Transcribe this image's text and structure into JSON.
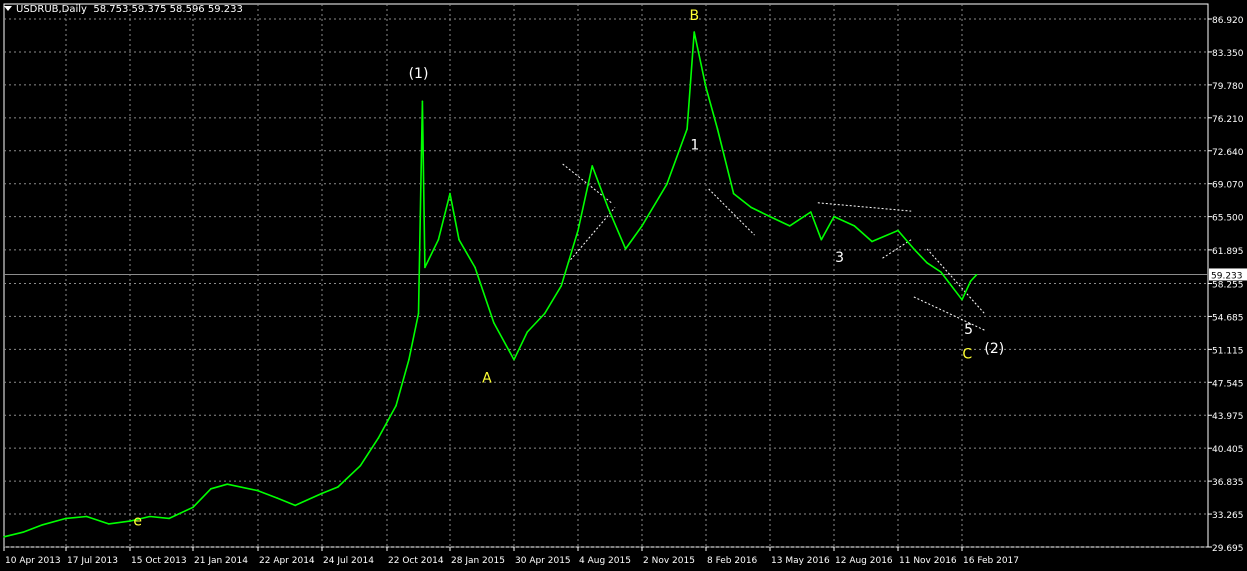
{
  "header": {
    "symbol": "USDRUB,Daily",
    "ohlc": "58.753 59.375 58.596 59.233"
  },
  "colors": {
    "background": "#000000",
    "grid": "#8c8c8c",
    "price_line": "#00ff00",
    "axis_text": "#ffffff",
    "label_yellow": "#ffff33",
    "label_white": "#ffffff",
    "current_price_line": "#8c8c8c"
  },
  "chart_data": {
    "type": "line",
    "current_price": 59.233,
    "current_price_label": "59.233",
    "ylim": [
      29.695,
      86.92
    ],
    "y_ticks": [
      "86.920",
      "83.350",
      "79.780",
      "76.210",
      "72.640",
      "69.070",
      "65.500",
      "61.895",
      "58.255",
      "54.685",
      "51.115",
      "47.545",
      "43.975",
      "40.405",
      "36.835",
      "33.265",
      "29.695"
    ],
    "x_ticks": [
      "10 Apr 2013",
      "17 Jul 2013",
      "15 Oct 2013",
      "21 Jan 2014",
      "22 Apr 2014",
      "24 Jul 2014",
      "22 Oct 2014",
      "28 Jan 2015",
      "30 Apr 2015",
      "4 Aug 2015",
      "2 Nov 2015",
      "8 Feb 2016",
      "13 May 2016",
      "12 Aug 2016",
      "11 Nov 2016",
      "16 Feb 2017"
    ],
    "series": [
      {
        "x": [
          "2013-04-10",
          "2013-05-10",
          "2013-06-10",
          "2013-07-17",
          "2013-08-15",
          "2013-09-15",
          "2013-10-15",
          "2013-11-15",
          "2013-12-15",
          "2014-01-21",
          "2014-02-15",
          "2014-03-10",
          "2014-04-22",
          "2014-05-20",
          "2014-06-15",
          "2014-07-24",
          "2014-08-15",
          "2014-09-15",
          "2014-10-10",
          "2014-11-05",
          "2014-11-25",
          "2014-12-10",
          "2014-12-16",
          "2014-12-20",
          "2015-01-10",
          "2015-01-28",
          "2015-02-10",
          "2015-03-05",
          "2015-04-01",
          "2015-04-30",
          "2015-05-20",
          "2015-06-15",
          "2015-07-10",
          "2015-08-04",
          "2015-08-24",
          "2015-09-15",
          "2015-10-10",
          "2015-11-02",
          "2015-12-10",
          "2016-01-10",
          "2016-01-21",
          "2016-02-08",
          "2016-02-25",
          "2016-03-20",
          "2016-04-15",
          "2016-05-13",
          "2016-06-10",
          "2016-07-10",
          "2016-07-25",
          "2016-08-12",
          "2016-09-10",
          "2016-10-05",
          "2016-11-11",
          "2016-12-05",
          "2016-12-25",
          "2017-01-15",
          "2017-02-16",
          "2017-03-01",
          "2017-03-10"
        ],
        "y": [
          30.8,
          31.3,
          32.1,
          32.8,
          33.0,
          32.2,
          32.5,
          33.0,
          32.8,
          34.0,
          36.0,
          36.5,
          35.8,
          35.0,
          34.2,
          35.5,
          36.2,
          38.5,
          41.5,
          45.0,
          50.0,
          55.0,
          78.0,
          60.0,
          63.0,
          68.0,
          63.0,
          60.0,
          54.0,
          50.0,
          53.0,
          55.0,
          58.0,
          64.0,
          71.0,
          66.5,
          62.0,
          64.5,
          69.0,
          75.0,
          85.5,
          79.5,
          75.0,
          68.0,
          66.5,
          65.5,
          64.5,
          66.0,
          63.0,
          65.5,
          64.5,
          62.8,
          64.0,
          62.0,
          60.5,
          59.5,
          56.5,
          58.5,
          59.2
        ]
      }
    ],
    "wave_labels": [
      {
        "text": "(1)",
        "x": "2014-12-10",
        "y": 80.5,
        "color": "white"
      },
      {
        "text": "B",
        "x": "2016-01-21",
        "y": 86.8,
        "color": "yellow"
      },
      {
        "text": "1",
        "x": "2016-01-22",
        "y": 72.8,
        "color": "white"
      },
      {
        "text": "A",
        "x": "2015-03-22",
        "y": 47.5,
        "color": "yellow"
      },
      {
        "text": "3",
        "x": "2016-08-20",
        "y": 60.6,
        "color": "white"
      },
      {
        "text": "e",
        "x": "2013-10-27",
        "y": 32.0,
        "color": "yellow"
      },
      {
        "text": "5",
        "x": "2017-02-26",
        "y": 52.8,
        "color": "white"
      },
      {
        "text": "C",
        "x": "2017-02-24",
        "y": 50.1,
        "color": "yellow"
      },
      {
        "text": "(2)",
        "x": "2017-04-06",
        "y": 50.7,
        "color": "white"
      }
    ],
    "trend_lines": [
      {
        "x1": "2015-07-12",
        "y1": 71.2,
        "x2": "2015-09-20",
        "y2": 67.0
      },
      {
        "x1": "2015-07-20",
        "y1": 60.5,
        "x2": "2015-09-25",
        "y2": 66.5
      },
      {
        "x1": "2016-02-12",
        "y1": 68.5,
        "x2": "2016-04-20",
        "y2": 63.5
      },
      {
        "x1": "2016-07-20",
        "y1": 67.0,
        "x2": "2016-12-01",
        "y2": 66.1
      },
      {
        "x1": "2016-10-20",
        "y1": 61.0,
        "x2": "2016-12-01",
        "y2": 63.0
      },
      {
        "x1": "2016-12-05",
        "y1": 56.8,
        "x2": "2017-03-22",
        "y2": 53.2
      },
      {
        "x1": "2016-12-25",
        "y1": 62.0,
        "x2": "2017-03-22",
        "y2": 55.0
      }
    ]
  }
}
